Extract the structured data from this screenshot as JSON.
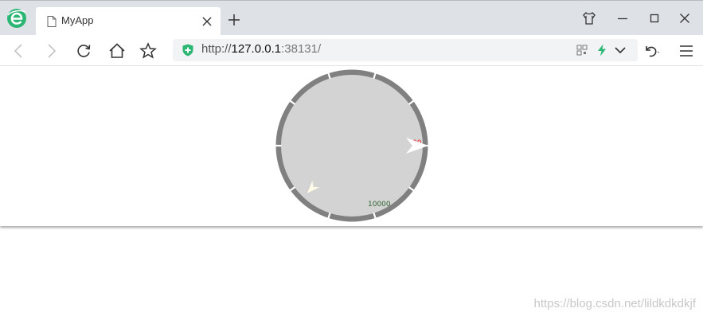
{
  "window": {
    "tab_title": "MyApp",
    "controls": [
      "skin-icon",
      "minimize-icon",
      "maximize-icon",
      "close-icon"
    ]
  },
  "toolbar": {
    "buttons": [
      "back-icon",
      "forward-icon",
      "reload-icon",
      "home-icon",
      "star-icon"
    ],
    "url_scheme": "http://",
    "url_host": "127.0.0.1",
    "url_rest": ":38131/"
  },
  "gauge": {
    "ring_label": "00",
    "ring_label_color": "#ff2020",
    "inner_value_label": "10000",
    "inner_value_color": "#336633",
    "face_color": "#d3d3d3",
    "ring_color": "#808080",
    "outer_pointer_level": 0.25,
    "inner_pointer_level": 0.62
  },
  "watermark": {
    "text": "https://blog.csdn.net/lildkdkdkjf"
  }
}
